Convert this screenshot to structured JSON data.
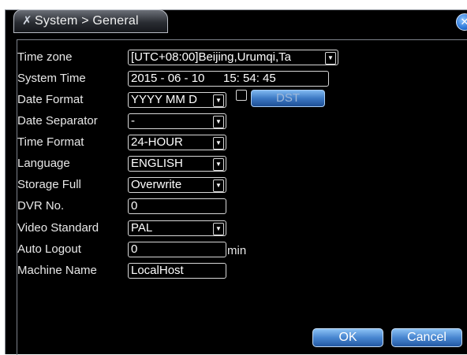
{
  "window": {
    "title": "System > General",
    "icon": "tools-icon",
    "close_icon": "close-icon"
  },
  "fields": {
    "time_zone": {
      "label": "Time zone",
      "value": "[UTC+08:00]Beijing,Urumqi,Ta"
    },
    "system_time": {
      "label": "System Time",
      "date": "2015 - 06 - 10",
      "time": "15: 54: 45"
    },
    "date_format": {
      "label": "Date Format",
      "value": "YYYY MM D"
    },
    "dst": {
      "label": "DST",
      "checked": false
    },
    "date_separator": {
      "label": "Date Separator",
      "value": "-"
    },
    "time_format": {
      "label": "Time Format",
      "value": "24-HOUR"
    },
    "language": {
      "label": "Language",
      "value": "ENGLISH"
    },
    "storage_full": {
      "label": "Storage Full",
      "value": "Overwrite"
    },
    "dvr_no": {
      "label": "DVR No.",
      "value": "0"
    },
    "video_standard": {
      "label": "Video Standard",
      "value": "PAL"
    },
    "auto_logout": {
      "label": "Auto Logout",
      "value": "0",
      "unit": "min"
    },
    "machine_name": {
      "label": "Machine Name",
      "value": "LocalHost"
    }
  },
  "buttons": {
    "ok": "OK",
    "cancel": "Cancel"
  },
  "colors": {
    "background": "#000000",
    "text": "#e8e8e8",
    "button_blue": "#4886d0"
  }
}
